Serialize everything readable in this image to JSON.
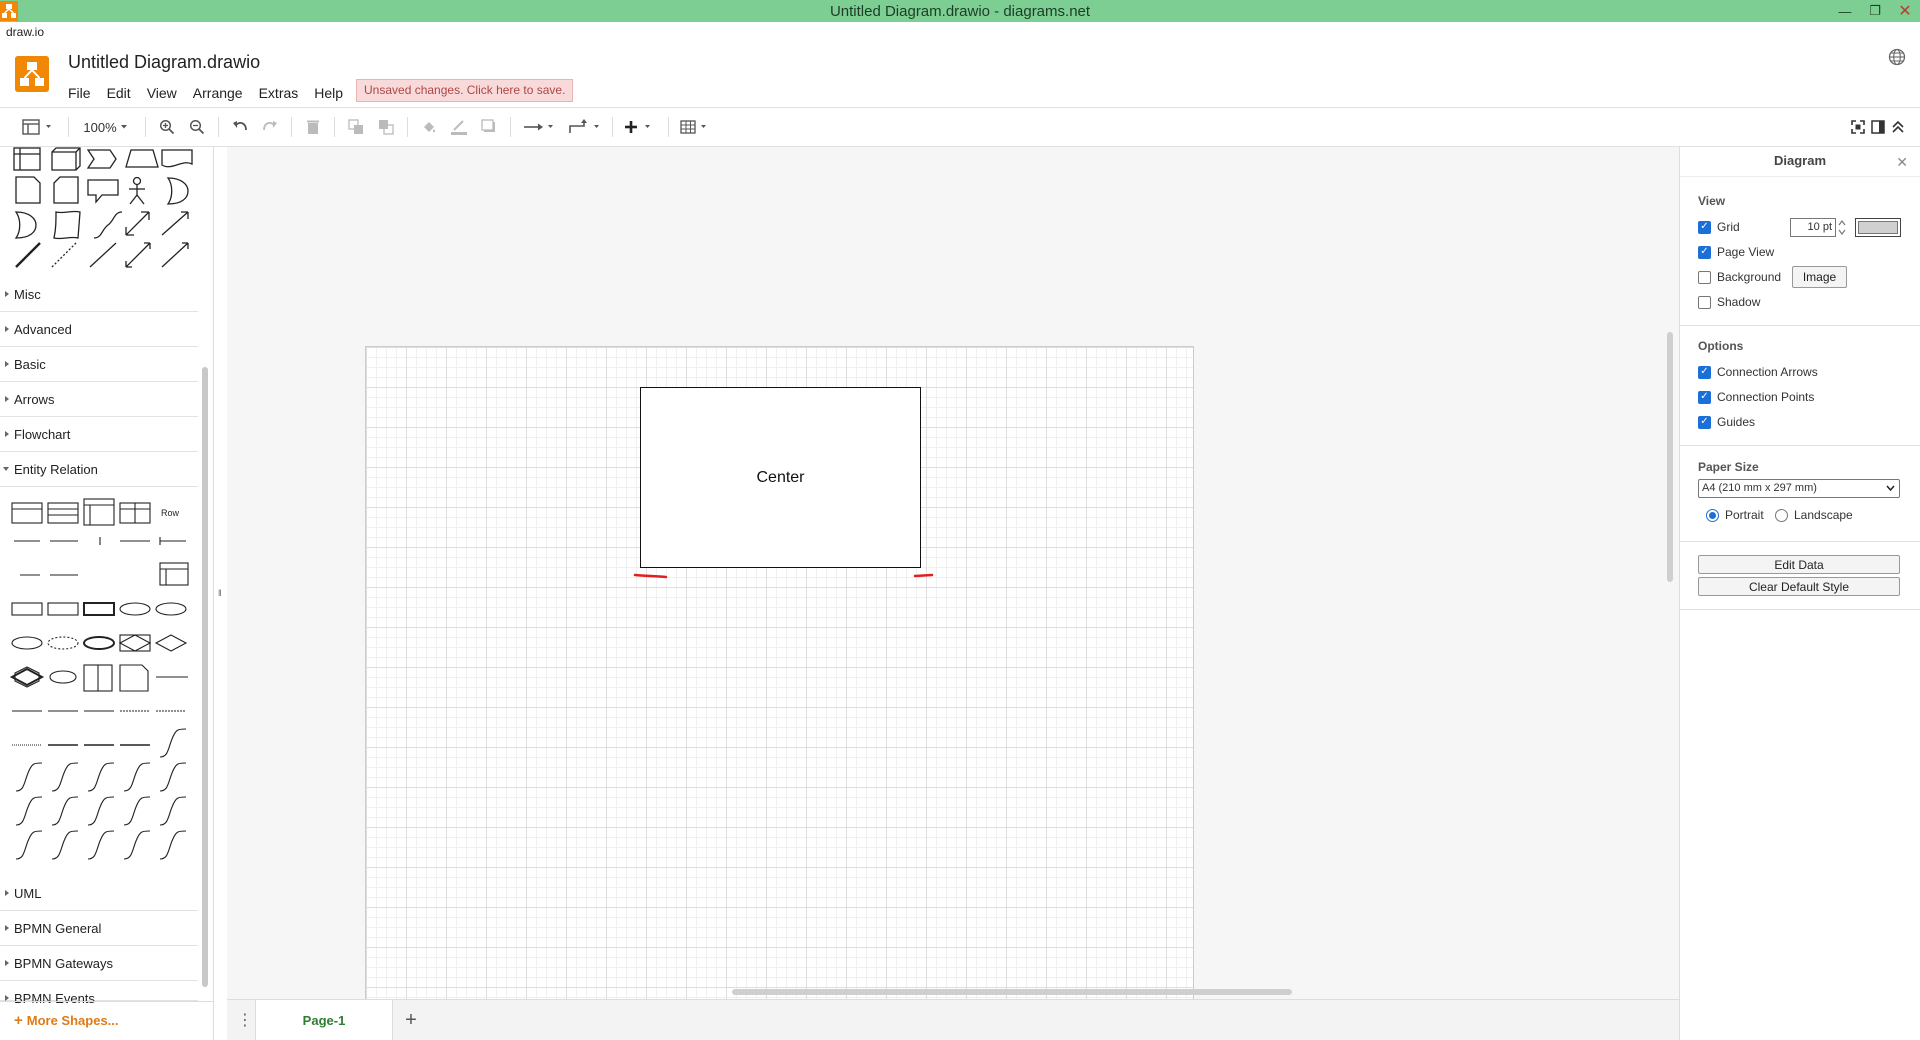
{
  "window": {
    "title": "Untitled Diagram.drawio - diagrams.net",
    "subtitle": "draw.io",
    "controls": [
      "minimize-icon",
      "restore-icon",
      "close-icon"
    ]
  },
  "header": {
    "doc_title": "Untitled Diagram.drawio",
    "menu": [
      "File",
      "Edit",
      "View",
      "Arrange",
      "Extras",
      "Help"
    ],
    "unsaved_notice": "Unsaved changes. Click here to save."
  },
  "toolbar": {
    "zoom": "100%",
    "icons": [
      "view-panels-icon",
      "zoom-in-icon",
      "zoom-out-icon",
      "undo-icon",
      "redo-icon",
      "delete-icon",
      "to-front-icon",
      "to-back-icon",
      "fill-color-icon",
      "line-color-icon",
      "shadow-icon",
      "connection-icon",
      "waypoints-icon",
      "insert-icon",
      "table-icon",
      "fullscreen-icon",
      "format-panel-icon",
      "collapse-icon"
    ]
  },
  "sidebar": {
    "sections": [
      {
        "label": "Misc",
        "open": false
      },
      {
        "label": "Advanced",
        "open": false
      },
      {
        "label": "Basic",
        "open": false
      },
      {
        "label": "Arrows",
        "open": false
      },
      {
        "label": "Flowchart",
        "open": false
      },
      {
        "label": "Entity Relation",
        "open": true
      },
      {
        "label": "UML",
        "open": false
      },
      {
        "label": "BPMN General",
        "open": false
      },
      {
        "label": "BPMN Gateways",
        "open": false
      },
      {
        "label": "BPMN Events",
        "open": false
      }
    ],
    "er_row_label": "Row",
    "more_shapes": "More Shapes..."
  },
  "canvas": {
    "shape_label": "Center"
  },
  "pages": {
    "tabs": [
      "Page-1"
    ]
  },
  "format_panel": {
    "title": "Diagram",
    "view_heading": "View",
    "grid_label": "Grid",
    "grid_checked": true,
    "grid_size": "10 pt",
    "page_view_label": "Page View",
    "page_view_checked": true,
    "background_label": "Background",
    "background_checked": false,
    "image_button": "Image",
    "shadow_label": "Shadow",
    "shadow_checked": false,
    "options_heading": "Options",
    "connection_arrows_label": "Connection Arrows",
    "connection_points_label": "Connection Points",
    "guides_label": "Guides",
    "paper_size_heading": "Paper Size",
    "paper_size_value": "A4 (210 mm x 297 mm)",
    "portrait_label": "Portrait",
    "landscape_label": "Landscape",
    "orientation": "Portrait",
    "edit_data_button": "Edit Data",
    "clear_style_button": "Clear Default Style"
  },
  "colors": {
    "titlebar": "#7dce92",
    "logo": "#f08705",
    "unsaved_bg": "#f8dada",
    "unsaved_text": "#b04646",
    "accent": "#1b6fd8",
    "more_shapes": "#e07b12",
    "page_tab_text": "#2e7d32",
    "annotation_red": "#e02020"
  }
}
